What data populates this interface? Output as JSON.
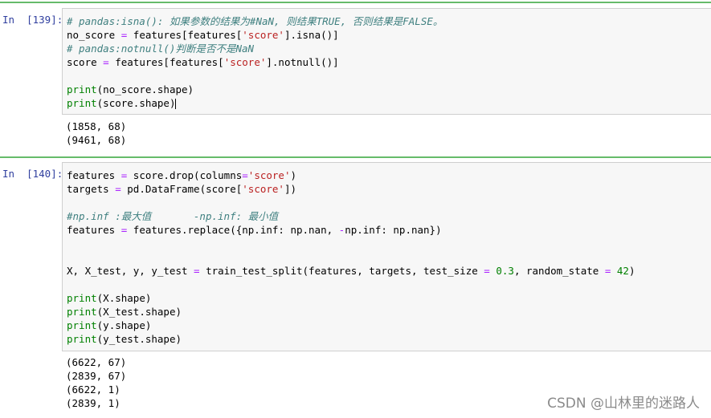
{
  "cells": [
    {
      "prompt": "In  [139]:",
      "code": [
        [
          [
            "c",
            "# pandas:isna(): 如果参数的结果为#NaN, 则结果TRUE, 否则结果是FALSE。"
          ]
        ],
        [
          [
            "t",
            "no_score "
          ],
          [
            "o",
            "="
          ],
          [
            "t",
            " features[features["
          ],
          [
            "s",
            "'score'"
          ],
          [
            "t",
            "].isna()]"
          ]
        ],
        [
          [
            "c",
            "# pandas:notnull()判断是否不是NaN"
          ]
        ],
        [
          [
            "t",
            "score "
          ],
          [
            "o",
            "="
          ],
          [
            "t",
            " features[features["
          ],
          [
            "s",
            "'score'"
          ],
          [
            "t",
            "].notnull()]"
          ]
        ],
        [],
        [
          [
            "k",
            "print"
          ],
          [
            "t",
            "(no_score.shape)"
          ]
        ],
        [
          [
            "k",
            "print"
          ],
          [
            "t",
            "(score.shape)"
          ]
        ]
      ],
      "output": [
        "(1858, 68)",
        "(9461, 68)"
      ]
    },
    {
      "prompt": "In  [140]:",
      "code": [
        [
          [
            "t",
            "features "
          ],
          [
            "o",
            "="
          ],
          [
            "t",
            " score.drop(columns"
          ],
          [
            "o",
            "="
          ],
          [
            "s",
            "'score'"
          ],
          [
            "t",
            ")"
          ]
        ],
        [
          [
            "t",
            "targets "
          ],
          [
            "o",
            "="
          ],
          [
            "t",
            " pd.DataFrame(score["
          ],
          [
            "s",
            "'score'"
          ],
          [
            "t",
            "])"
          ]
        ],
        [],
        [
          [
            "c",
            "#np.inf :最大值       -np.inf: 最小值"
          ]
        ],
        [
          [
            "t",
            "features "
          ],
          [
            "o",
            "="
          ],
          [
            "t",
            " features.replace({np.inf: np.nan, "
          ],
          [
            "o",
            "-"
          ],
          [
            "t",
            "np.inf: np.nan})"
          ]
        ],
        [],
        [],
        [
          [
            "t",
            "X, X_test, y, y_test "
          ],
          [
            "o",
            "="
          ],
          [
            "t",
            " train_test_split(features, targets, test_size "
          ],
          [
            "o",
            "="
          ],
          [
            "t",
            " "
          ],
          [
            "n",
            "0.3"
          ],
          [
            "t",
            ", random_state "
          ],
          [
            "o",
            "="
          ],
          [
            "t",
            " "
          ],
          [
            "n",
            "42"
          ],
          [
            "t",
            ")"
          ]
        ],
        [],
        [
          [
            "k",
            "print"
          ],
          [
            "t",
            "(X.shape)"
          ]
        ],
        [
          [
            "k",
            "print"
          ],
          [
            "t",
            "(X_test.shape)"
          ]
        ],
        [
          [
            "k",
            "print"
          ],
          [
            "t",
            "(y.shape)"
          ]
        ],
        [
          [
            "k",
            "print"
          ],
          [
            "t",
            "(y_test.shape)"
          ]
        ]
      ],
      "output": [
        "(6622, 67)",
        "(2839, 67)",
        "(6622, 1)",
        "(2839, 1)"
      ]
    }
  ],
  "watermark": "CSDN @山林里的迷路人",
  "colors": {
    "prompt": "#303f9f",
    "comment": "#408080",
    "string": "#ba2121",
    "keyword": "#008000",
    "operator": "#aa22ff",
    "selected_border": "#66bb6a"
  }
}
